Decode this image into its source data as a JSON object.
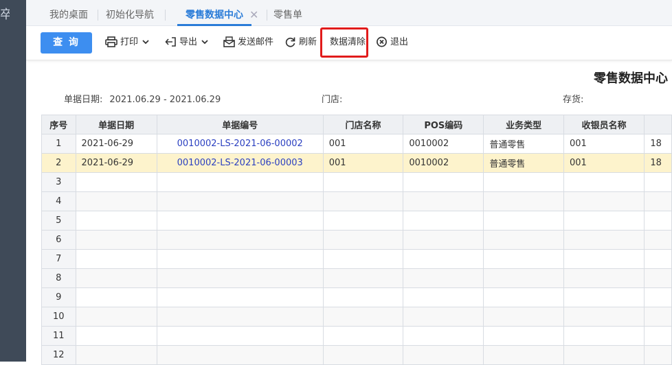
{
  "left_rail": {
    "glyph": "卒"
  },
  "tabs": [
    {
      "label": "我的桌面"
    },
    {
      "label": "初始化导航"
    },
    {
      "label": "零售数据中心",
      "active": true,
      "close_glyph": "✕"
    },
    {
      "label": "零售单"
    }
  ],
  "toolbar": {
    "query_label": "查 询",
    "print_label": "打印",
    "export_label": "导出",
    "email_label": "发送邮件",
    "refresh_label": "刷新",
    "clear_label": "数据清除",
    "exit_label": "退出",
    "icons": [
      "printer-icon",
      "export-icon",
      "email-icon",
      "refresh-icon",
      "exit-icon"
    ]
  },
  "report": {
    "title": "零售数据中心",
    "filters": {
      "date_label": "单据日期:",
      "date_value": "2021.06.29 - 2021.06.29",
      "store_label": "门店:",
      "stock_label": "存货:"
    }
  },
  "table": {
    "columns": [
      "序号",
      "单据日期",
      "单据编号",
      "门店名称",
      "POS编码",
      "业务类型",
      "收银员名称",
      ""
    ],
    "rows": [
      [
        "1",
        "2021-06-29",
        "0010002-LS-2021-06-00002",
        "001",
        "0010002",
        "普通零售",
        "001",
        "18"
      ],
      [
        "2",
        "2021-06-29",
        "0010002-LS-2021-06-00003",
        "001",
        "0010002",
        "普通零售",
        "001",
        "18"
      ],
      [
        "3",
        "",
        "",
        "",
        "",
        "",
        "",
        ""
      ],
      [
        "4",
        "",
        "",
        "",
        "",
        "",
        "",
        ""
      ],
      [
        "5",
        "",
        "",
        "",
        "",
        "",
        "",
        ""
      ],
      [
        "6",
        "",
        "",
        "",
        "",
        "",
        "",
        ""
      ],
      [
        "7",
        "",
        "",
        "",
        "",
        "",
        "",
        ""
      ],
      [
        "8",
        "",
        "",
        "",
        "",
        "",
        "",
        ""
      ],
      [
        "9",
        "",
        "",
        "",
        "",
        "",
        "",
        ""
      ],
      [
        "10",
        "",
        "",
        "",
        "",
        "",
        "",
        ""
      ],
      [
        "11",
        "",
        "",
        "",
        "",
        "",
        "",
        ""
      ],
      [
        "12",
        "",
        "",
        "",
        "",
        "",
        "",
        ""
      ]
    ],
    "selected_row": 2
  },
  "colors": {
    "accent": "#3d8ef0",
    "highlight_border": "#e11b1b",
    "link": "#2a3fc0",
    "selected_row": "#fdf3cc"
  }
}
